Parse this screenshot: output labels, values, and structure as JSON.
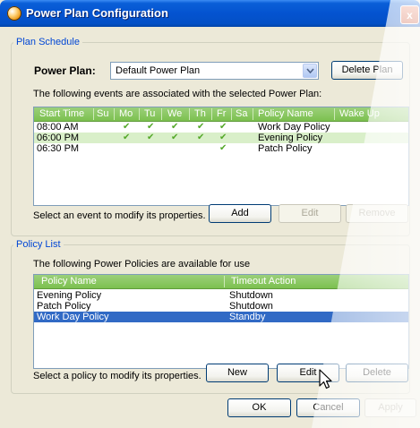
{
  "window": {
    "title": "Power Plan Configuration",
    "close_glyph": "x"
  },
  "plan_schedule": {
    "legend": "Plan Schedule",
    "power_plan_label": "Power Plan:",
    "power_plan_value": "Default Power Plan",
    "delete_plan_button": "Delete Plan",
    "events_caption": "The following events are associated with the selected Power Plan:",
    "columns": [
      "Start Time",
      "Su",
      "Mo",
      "Tu",
      "We",
      "Th",
      "Fr",
      "Sa",
      "Policy Name",
      "Wake Up"
    ],
    "events": [
      {
        "time": "08:00 AM",
        "days": [
          false,
          true,
          true,
          true,
          true,
          true,
          false
        ],
        "policy": "Work Day Policy"
      },
      {
        "time": "06:00 PM",
        "days": [
          false,
          true,
          true,
          true,
          true,
          true,
          false
        ],
        "policy": "Evening Policy"
      },
      {
        "time": "06:30 PM",
        "days": [
          false,
          false,
          false,
          false,
          false,
          true,
          false
        ],
        "policy": "Patch Policy"
      }
    ],
    "check_glyph": "✔",
    "hint": "Select an event to modify its properties.",
    "buttons": {
      "add": "Add",
      "edit": "Edit",
      "remove": "Remove"
    }
  },
  "policy_list": {
    "legend": "Policy List",
    "caption": "The following Power Policies are available for use",
    "columns": [
      "Policy Name",
      "Timeout Action"
    ],
    "rows": [
      {
        "name": "Evening Policy",
        "action": "Shutdown",
        "selected": false
      },
      {
        "name": "Patch Policy",
        "action": "Shutdown",
        "selected": false
      },
      {
        "name": "Work Day Policy",
        "action": "Standby",
        "selected": true
      }
    ],
    "hint": "Select a policy to modify its properties.",
    "buttons": {
      "new": "New",
      "edit": "Edit",
      "delete": "Delete"
    }
  },
  "dialog_buttons": {
    "ok": "OK",
    "cancel": "Cancel",
    "apply": "Apply"
  },
  "icons": {
    "title": "power-plan-icon",
    "combo": "chevron-down-icon",
    "cursor": "mouse-pointer-icon"
  },
  "colors": {
    "title_bar": "#0453d0",
    "list_header": "#7cc04f",
    "alt_row": "#d9efc9",
    "selection": "#316ac5",
    "legend_text": "#0046d5",
    "check": "#54a829"
  }
}
